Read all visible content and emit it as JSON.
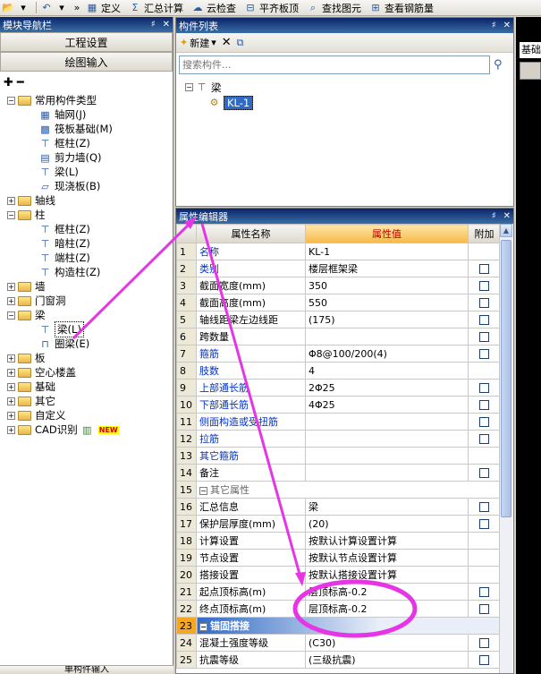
{
  "toolbar": {
    "items": [
      {
        "label": "定义",
        "icon": "define-icon"
      },
      {
        "label": "汇总计算",
        "icon": "sigma-icon"
      },
      {
        "label": "云检查",
        "icon": "cloud-check-icon"
      },
      {
        "label": "平齐板顶",
        "icon": "align-slab-icon"
      },
      {
        "label": "查找图元",
        "icon": "find-element-icon"
      },
      {
        "label": "查看钢筋量",
        "icon": "rebar-view-icon"
      }
    ]
  },
  "nav": {
    "title": "模块导航栏",
    "btn_project": "工程设置",
    "btn_draw": "绘图输入",
    "bottom": "单构件输入",
    "tree": [
      {
        "label": "常用构件类型",
        "level": 0,
        "exp": "−",
        "folder": true
      },
      {
        "label": "轴网(J)",
        "level": 1,
        "icon": "grid-icon"
      },
      {
        "label": "筏板基础(M)",
        "level": 1,
        "icon": "raft-icon"
      },
      {
        "label": "框柱(Z)",
        "level": 1,
        "icon": "column-icon"
      },
      {
        "label": "剪力墙(Q)",
        "level": 1,
        "icon": "wall-icon"
      },
      {
        "label": "梁(L)",
        "level": 1,
        "icon": "beam-icon"
      },
      {
        "label": "现浇板(B)",
        "level": 1,
        "icon": "slab-icon"
      },
      {
        "label": "轴线",
        "level": 0,
        "exp": "+",
        "folder": true
      },
      {
        "label": "柱",
        "level": 0,
        "exp": "−",
        "folder": true
      },
      {
        "label": "框柱(Z)",
        "level": 1,
        "icon": "column-icon"
      },
      {
        "label": "暗柱(Z)",
        "level": 1,
        "icon": "column-icon"
      },
      {
        "label": "端柱(Z)",
        "level": 1,
        "icon": "column-icon"
      },
      {
        "label": "构造柱(Z)",
        "level": 1,
        "icon": "column-icon"
      },
      {
        "label": "墙",
        "level": 0,
        "exp": "+",
        "folder": true
      },
      {
        "label": "门窗洞",
        "level": 0,
        "exp": "+",
        "folder": true
      },
      {
        "label": "梁",
        "level": 0,
        "exp": "−",
        "folder": true
      },
      {
        "label": "梁(L)",
        "level": 1,
        "icon": "beam-icon",
        "selected": true
      },
      {
        "label": "圈梁(E)",
        "level": 1,
        "icon": "ring-beam-icon"
      },
      {
        "label": "板",
        "level": 0,
        "exp": "+",
        "folder": true
      },
      {
        "label": "空心楼盖",
        "level": 0,
        "exp": "+",
        "folder": true
      },
      {
        "label": "基础",
        "level": 0,
        "exp": "+",
        "folder": true
      },
      {
        "label": "其它",
        "level": 0,
        "exp": "+",
        "folder": true
      },
      {
        "label": "自定义",
        "level": 0,
        "exp": "+",
        "folder": true
      },
      {
        "label": "CAD识别",
        "level": 0,
        "exp": "+",
        "folder": true,
        "badge": "NEW"
      }
    ]
  },
  "comp": {
    "title": "构件列表",
    "new_label": "新建",
    "search_placeholder": "搜索构件...",
    "root": "梁",
    "item": "KL-1"
  },
  "prop": {
    "title": "属性编辑器",
    "col_name": "属性名称",
    "col_value": "属性值",
    "col_add": "附加",
    "rows": [
      {
        "n": "1",
        "name": "名称",
        "value": "KL-1",
        "style": "blue",
        "cb": false
      },
      {
        "n": "2",
        "name": "类别",
        "value": "楼层框架梁",
        "style": "blue",
        "cb": true
      },
      {
        "n": "3",
        "name": "截面宽度(mm)",
        "value": "350",
        "style": "black",
        "cb": true
      },
      {
        "n": "4",
        "name": "截面高度(mm)",
        "value": "550",
        "style": "black",
        "cb": true
      },
      {
        "n": "5",
        "name": "轴线距梁左边线距",
        "value": "(175)",
        "style": "black",
        "cb": true
      },
      {
        "n": "6",
        "name": "跨数量",
        "value": "",
        "style": "black",
        "cb": true
      },
      {
        "n": "7",
        "name": "箍筋",
        "value": "Φ8@100/200(4)",
        "style": "blue",
        "cb": true
      },
      {
        "n": "8",
        "name": "肢数",
        "value": "4",
        "style": "blue",
        "cb": false
      },
      {
        "n": "9",
        "name": "上部通长筋",
        "value": "2Φ25",
        "style": "blue",
        "cb": true
      },
      {
        "n": "10",
        "name": "下部通长筋",
        "value": "4Φ25",
        "style": "blue",
        "cb": true
      },
      {
        "n": "11",
        "name": "侧面构造或受扭筋",
        "value": "",
        "style": "blue",
        "cb": true
      },
      {
        "n": "12",
        "name": "拉筋",
        "value": "",
        "style": "blue",
        "cb": true
      },
      {
        "n": "13",
        "name": "其它箍筋",
        "value": "",
        "style": "blue",
        "cb": false
      },
      {
        "n": "14",
        "name": "备注",
        "value": "",
        "style": "black",
        "cb": true
      },
      {
        "n": "15",
        "name": "其它属性",
        "value": "",
        "style": "section",
        "cb": false
      },
      {
        "n": "16",
        "name": "汇总信息",
        "value": "梁",
        "style": "indent",
        "cb": true
      },
      {
        "n": "17",
        "name": "保护层厚度(mm)",
        "value": "(20)",
        "style": "indent",
        "cb": true
      },
      {
        "n": "18",
        "name": "计算设置",
        "value": "按默认计算设置计算",
        "style": "indent",
        "cb": false
      },
      {
        "n": "19",
        "name": "节点设置",
        "value": "按默认节点设置计算",
        "style": "indent",
        "cb": false
      },
      {
        "n": "20",
        "name": "搭接设置",
        "value": "按默认搭接设置计算",
        "style": "indent",
        "cb": false
      },
      {
        "n": "21",
        "name": "起点顶标高(m)",
        "value": "层顶标高-0.2",
        "style": "indent",
        "cb": true
      },
      {
        "n": "22",
        "name": "终点顶标高(m)",
        "value": "层顶标高-0.2",
        "style": "indent",
        "cb": true
      },
      {
        "n": "23",
        "name": "锚固搭接",
        "value": "",
        "style": "section-active",
        "cb": false
      },
      {
        "n": "24",
        "name": "混凝土强度等级",
        "value": "(C30)",
        "style": "indent",
        "cb": true
      },
      {
        "n": "25",
        "name": "抗震等级",
        "value": "(三级抗震)",
        "style": "indent",
        "cb": true
      }
    ]
  },
  "rstrip": {
    "tab": "基础"
  },
  "annotation": {
    "color": "#e535e5"
  }
}
